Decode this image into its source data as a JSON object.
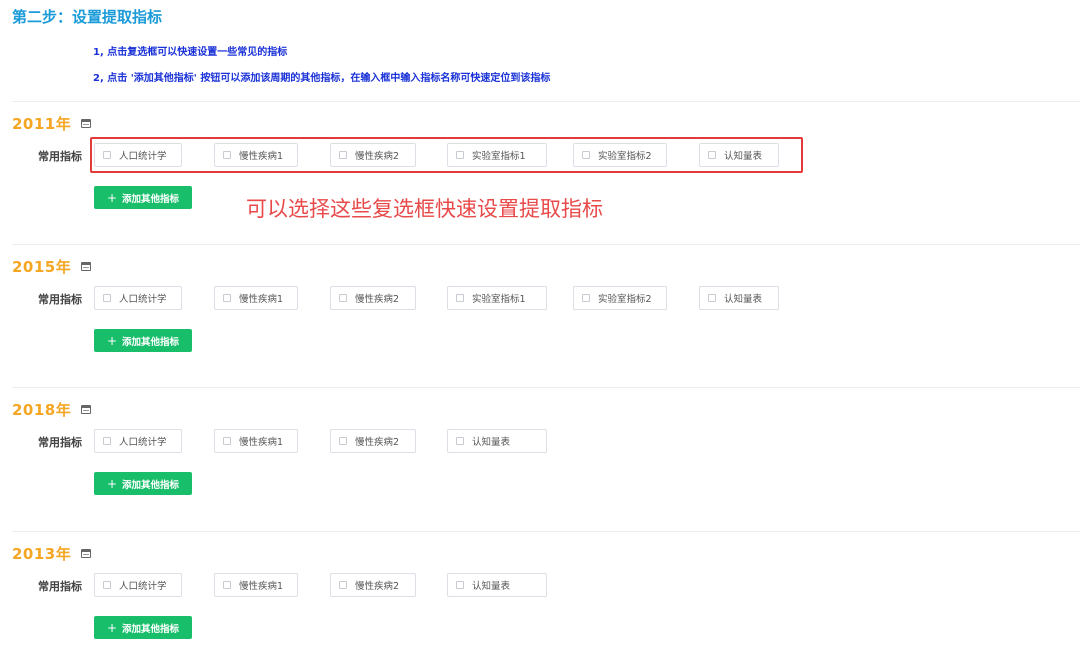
{
  "step_title": "第二步：设置提取指标",
  "instructions": [
    "1, 点击复选框可以快速设置一些常见的指标",
    "2, 点击 '添加其他指标' 按钮可以添加该周期的其他指标，在输入框中输入指标名称可快速定位到该指标"
  ],
  "common_label": "常用指标",
  "add_button_label": "添加其他指标",
  "annotation": "可以选择这些复选框快速设置提取指标",
  "colors": {
    "title": "#1b9bd8",
    "year": "#f5a623",
    "add_button": "#19be6b",
    "annotation": "#e84a4a"
  },
  "sections": [
    {
      "year": "2011年",
      "indicators": [
        "人口统计学",
        "慢性疾病1",
        "慢性疾病2",
        "实验室指标1",
        "实验室指标2",
        "认知量表"
      ]
    },
    {
      "year": "2015年",
      "indicators": [
        "人口统计学",
        "慢性疾病1",
        "慢性疾病2",
        "实验室指标1",
        "实验室指标2",
        "认知量表"
      ]
    },
    {
      "year": "2018年",
      "indicators": [
        "人口统计学",
        "慢性疾病1",
        "慢性疾病2",
        "认知量表"
      ]
    },
    {
      "year": "2013年",
      "indicators": [
        "人口统计学",
        "慢性疾病1",
        "慢性疾病2",
        "认知量表"
      ]
    }
  ]
}
